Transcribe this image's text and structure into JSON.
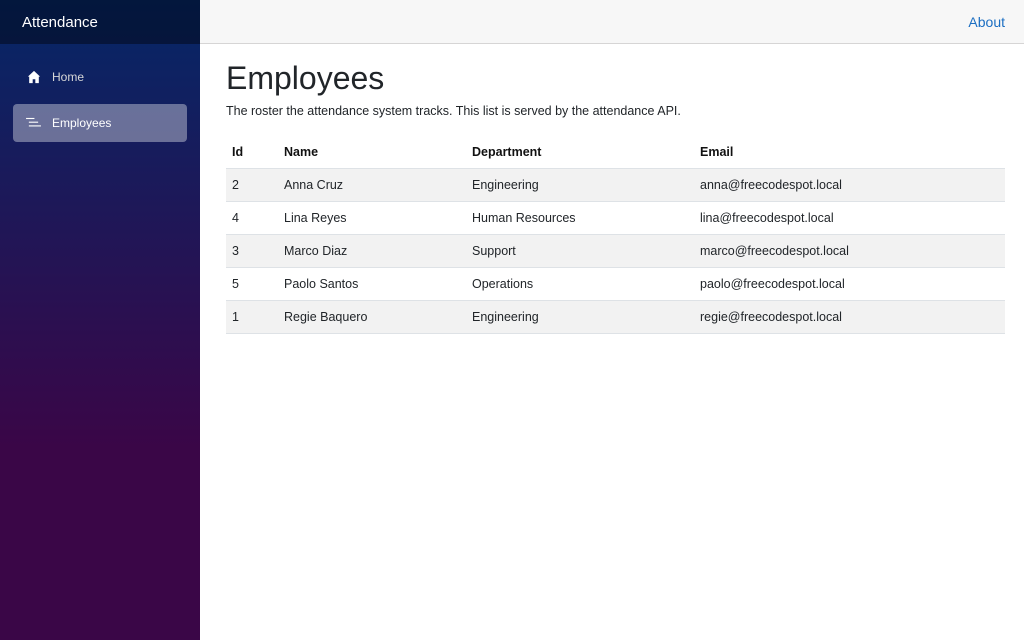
{
  "sidebar": {
    "brand": "Attendance",
    "items": [
      {
        "label": "Home",
        "icon": "home-icon",
        "active": false
      },
      {
        "label": "Employees",
        "icon": "list-icon",
        "active": true
      }
    ]
  },
  "topbar": {
    "about_label": "About"
  },
  "main": {
    "title": "Employees",
    "subtitle": "The roster the attendance system tracks. This list is served by the attendance API.",
    "table": {
      "headers": [
        "Id",
        "Name",
        "Department",
        "Email"
      ],
      "rows": [
        [
          "2",
          "Anna Cruz",
          "Engineering",
          "anna@freecodespot.local"
        ],
        [
          "4",
          "Lina Reyes",
          "Human Resources",
          "lina@freecodespot.local"
        ],
        [
          "3",
          "Marco Diaz",
          "Support",
          "marco@freecodespot.local"
        ],
        [
          "5",
          "Paolo Santos",
          "Operations",
          "paolo@freecodespot.local"
        ],
        [
          "1",
          "Regie Baquero",
          "Engineering",
          "regie@freecodespot.local"
        ]
      ]
    }
  },
  "colors": {
    "sidebar_top": "#052767",
    "sidebar_bottom": "#3a0647",
    "link": "#1b6ec2",
    "stripe": "#f2f2f2"
  }
}
